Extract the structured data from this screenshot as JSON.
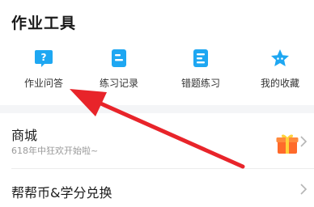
{
  "tools_section": {
    "title": "作业工具",
    "items": [
      {
        "label": "作业问答",
        "icon": "question-bubble-icon"
      },
      {
        "label": "练习记录",
        "icon": "practice-record-icon"
      },
      {
        "label": "错题练习",
        "icon": "wrong-question-icon"
      },
      {
        "label": "我的收藏",
        "icon": "favorite-star-icon"
      }
    ]
  },
  "mall": {
    "title": "商城",
    "subtitle": "618年中狂欢开始啦~",
    "icon": "gift-box-icon"
  },
  "coin_exchange": {
    "title": "帮帮币&学分兑换"
  },
  "colors": {
    "accent_blue": "#1ea7f2",
    "arrow_red": "#e8242a",
    "gift_orange": "#ff6a2a"
  }
}
